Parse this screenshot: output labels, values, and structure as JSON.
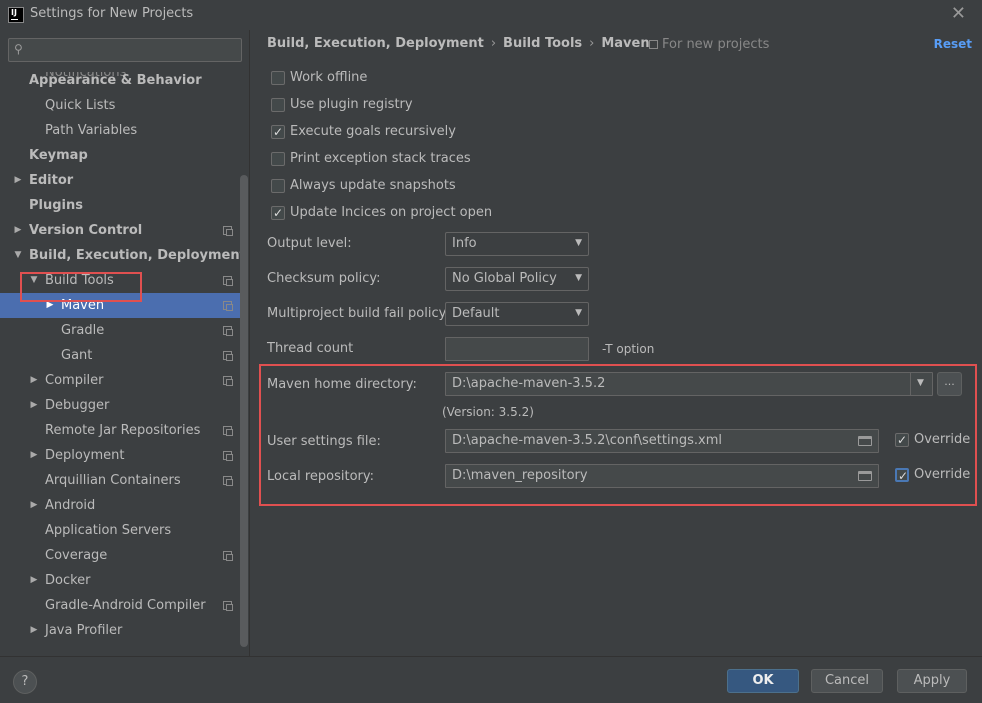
{
  "window": {
    "title": "Settings for New Projects",
    "app_icon_text": "IJ"
  },
  "search": {
    "placeholder": ""
  },
  "sidebar": {
    "items": [
      {
        "label": "Notifications",
        "bold": false,
        "arrow": "",
        "copy": false
      },
      {
        "label": "Appearance & Behavior",
        "bold": true,
        "arrow": "",
        "copy": false
      },
      {
        "label": "Quick Lists",
        "bold": false,
        "arrow": "",
        "copy": false
      },
      {
        "label": "Path Variables",
        "bold": false,
        "arrow": "",
        "copy": false
      },
      {
        "label": "Keymap",
        "bold": true,
        "arrow": "",
        "copy": false
      },
      {
        "label": "Editor",
        "bold": true,
        "arrow": "▶",
        "copy": false
      },
      {
        "label": "Plugins",
        "bold": true,
        "arrow": "",
        "copy": false
      },
      {
        "label": "Version Control",
        "bold": true,
        "arrow": "▶",
        "copy": true
      },
      {
        "label": "Build, Execution, Deployment",
        "bold": true,
        "arrow": "▼",
        "copy": false
      },
      {
        "label": "Build Tools",
        "bold": false,
        "arrow": "▼",
        "copy": true
      },
      {
        "label": "Maven",
        "bold": false,
        "arrow": "▶",
        "copy": true,
        "selected": true
      },
      {
        "label": "Gradle",
        "bold": false,
        "arrow": "",
        "copy": true
      },
      {
        "label": "Gant",
        "bold": false,
        "arrow": "",
        "copy": true
      },
      {
        "label": "Compiler",
        "bold": false,
        "arrow": "▶",
        "copy": true
      },
      {
        "label": "Debugger",
        "bold": false,
        "arrow": "▶",
        "copy": false
      },
      {
        "label": "Remote Jar Repositories",
        "bold": false,
        "arrow": "",
        "copy": true
      },
      {
        "label": "Deployment",
        "bold": false,
        "arrow": "▶",
        "copy": true
      },
      {
        "label": "Arquillian Containers",
        "bold": false,
        "arrow": "",
        "copy": true
      },
      {
        "label": "Android",
        "bold": false,
        "arrow": "▶",
        "copy": false
      },
      {
        "label": "Application Servers",
        "bold": false,
        "arrow": "",
        "copy": false
      },
      {
        "label": "Coverage",
        "bold": false,
        "arrow": "",
        "copy": true
      },
      {
        "label": "Docker",
        "bold": false,
        "arrow": "▶",
        "copy": false
      },
      {
        "label": "Gradle-Android Compiler",
        "bold": false,
        "arrow": "",
        "copy": true
      },
      {
        "label": "Java Profiler",
        "bold": false,
        "arrow": "▶",
        "copy": false
      }
    ]
  },
  "header": {
    "crumbs": [
      "Build, Execution, Deployment",
      "Build Tools",
      "Maven"
    ],
    "separator": "›",
    "scope": "For new projects",
    "reset": "Reset"
  },
  "options": {
    "work_offline": {
      "label": "Work offline",
      "checked": false
    },
    "plugin_registry": {
      "label": "Use plugin registry",
      "checked": false
    },
    "execute_goals": {
      "label": "Execute goals recursively",
      "checked": true
    },
    "print_exception": {
      "label": "Print exception stack traces",
      "checked": false
    },
    "update_snapshots": {
      "label": "Always update snapshots",
      "checked": false
    },
    "update_indices": {
      "label": "Update Incices on project open",
      "checked": true
    }
  },
  "fields": {
    "output_level": {
      "label": "Output level:",
      "value": "Info"
    },
    "checksum_policy": {
      "label": "Checksum policy:",
      "value": "No Global Policy"
    },
    "fail_policy": {
      "label": "Multiproject build fail policy:",
      "value": "Default"
    },
    "thread_count": {
      "label": "Thread count",
      "value": "",
      "hint": "-T option"
    },
    "maven_home": {
      "label": "Maven home directory:",
      "value": "D:\\apache-maven-3.5.2",
      "version": "(Version: 3.5.2)",
      "browse": "..."
    },
    "user_settings": {
      "label": "User settings file:",
      "value": "D:\\apache-maven-3.5.2\\conf\\settings.xml",
      "override_label": "Override",
      "override": true
    },
    "local_repo": {
      "label": "Local repository:",
      "value": "D:\\maven_repository",
      "override_label": "Override",
      "override": true
    }
  },
  "footer": {
    "help": "?",
    "ok": "OK",
    "cancel": "Cancel",
    "apply": "Apply"
  },
  "colors": {
    "background": "#3c3f41",
    "selection": "#4b6eaf",
    "accent_link": "#589df6",
    "highlight": "#e05050",
    "primary_button": "#365880"
  }
}
